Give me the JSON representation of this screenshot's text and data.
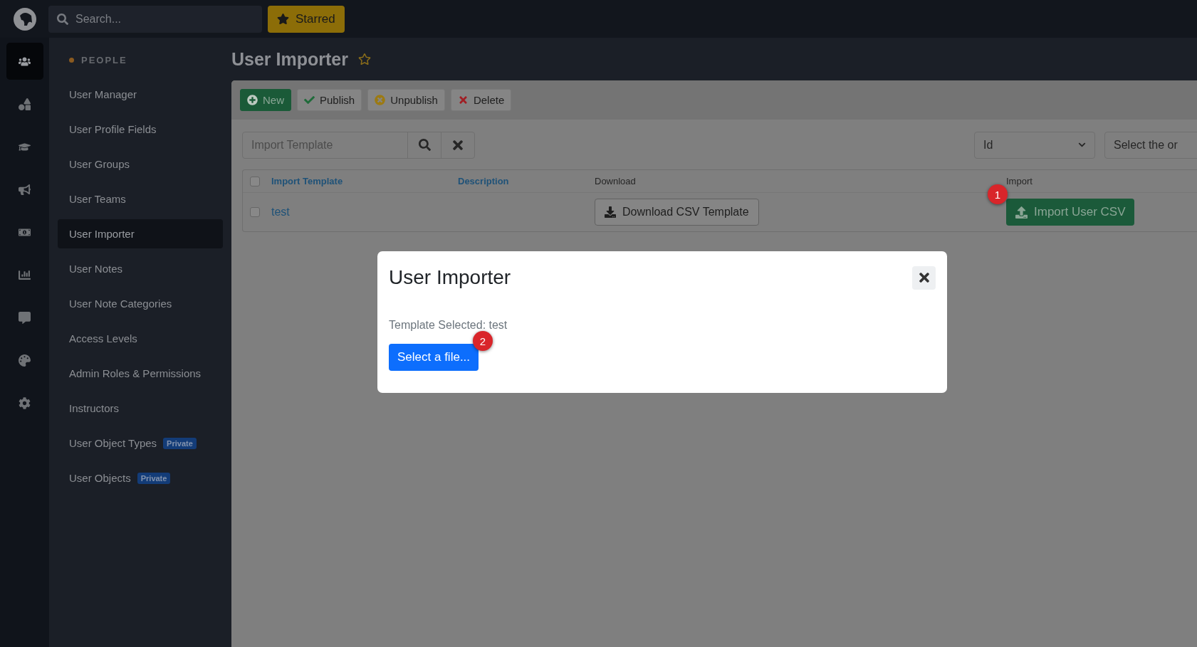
{
  "topbar": {
    "search": {
      "placeholder": "Search..."
    },
    "starred_button": "Starred"
  },
  "rail": [
    {
      "selected": true
    },
    {
      "selected": false
    },
    {
      "selected": false
    },
    {
      "selected": false
    },
    {
      "selected": false
    },
    {
      "selected": false
    },
    {
      "selected": false
    },
    {
      "selected": false
    },
    {
      "selected": false
    }
  ],
  "sidebar": {
    "section": "PEOPLE",
    "items": [
      {
        "label": "User Manager",
        "selected": false
      },
      {
        "label": "User Profile Fields",
        "selected": false
      },
      {
        "label": "User Groups",
        "selected": false
      },
      {
        "label": "User Teams",
        "selected": false
      },
      {
        "label": "User Importer",
        "selected": true
      },
      {
        "label": "User Notes",
        "selected": false
      },
      {
        "label": "User Note Categories",
        "selected": false
      },
      {
        "label": "Access Levels",
        "selected": false
      },
      {
        "label": "Admin Roles & Permissions",
        "selected": false
      },
      {
        "label": "Instructors",
        "selected": false
      },
      {
        "label": "User Object Types",
        "selected": false,
        "badge": "Private"
      },
      {
        "label": "User Objects",
        "selected": false,
        "badge": "Private"
      }
    ]
  },
  "page": {
    "title": "User Importer",
    "starred": false
  },
  "toolbar": [
    {
      "kind": "new",
      "label": "New"
    },
    {
      "kind": "publish",
      "label": "Publish"
    },
    {
      "kind": "unpublish",
      "label": "Unpublish"
    },
    {
      "kind": "delete",
      "label": "Delete"
    }
  ],
  "filter": {
    "search": {
      "placeholder": "Import Template"
    },
    "sort": {
      "value": "Id"
    },
    "order": {
      "value": "Select the or"
    }
  },
  "table": {
    "header_checked": false,
    "columns": [
      {
        "label": "Import Template",
        "sortable": true
      },
      {
        "label": "Description",
        "sortable": true
      },
      {
        "label": "Download",
        "sortable": false
      },
      {
        "label": "Import",
        "sortable": false
      }
    ],
    "rows": [
      {
        "checked": false,
        "name": "test",
        "download": "Download CSV Template",
        "import": "Import User CSV",
        "import_marker": "1"
      }
    ]
  },
  "modal": {
    "title": "User Importer",
    "text": "Template Selected: test",
    "button": "Select a file...",
    "button_marker": "2"
  }
}
